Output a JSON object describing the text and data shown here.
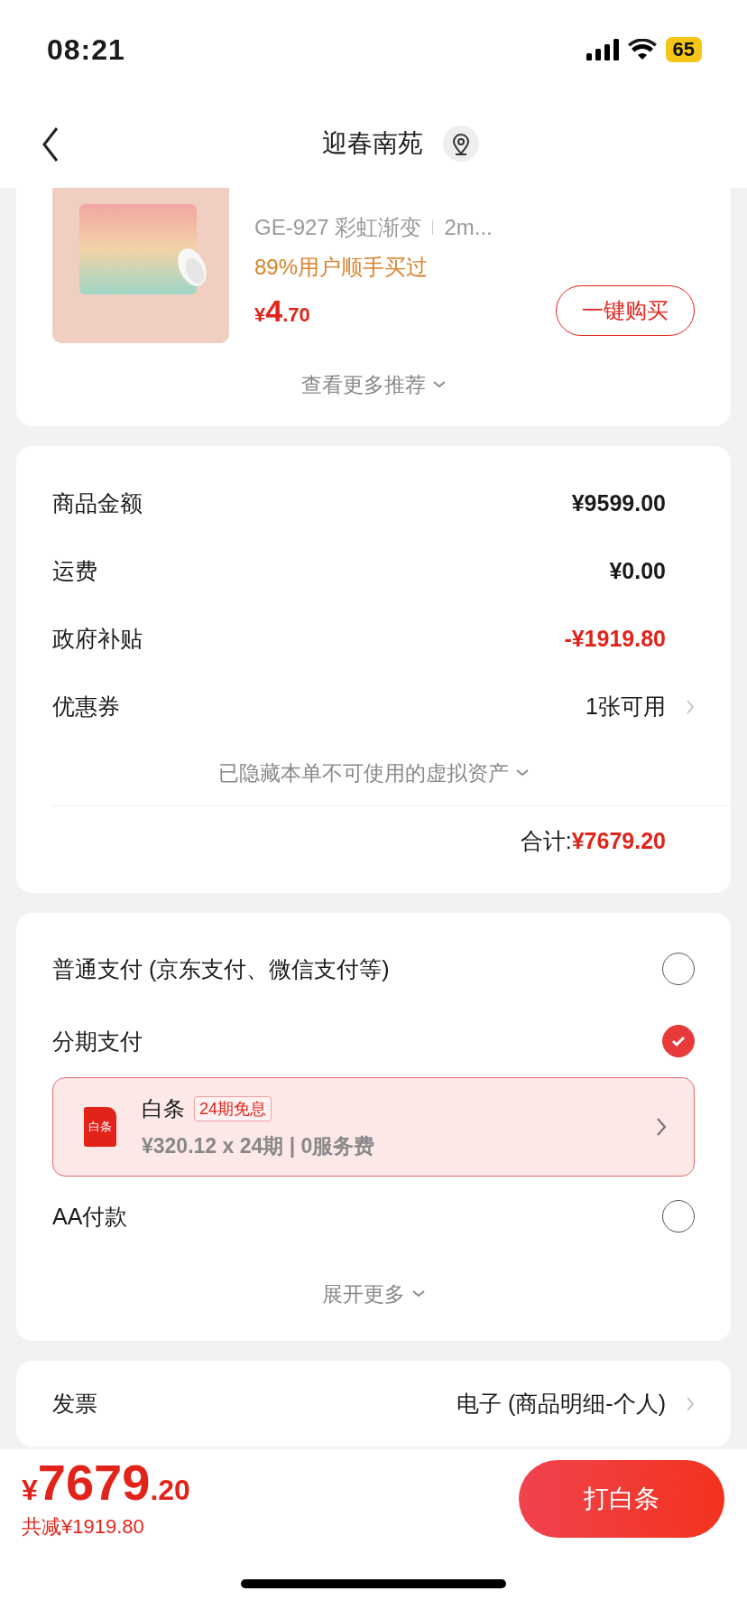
{
  "status_bar": {
    "time": "08:21",
    "battery": "65"
  },
  "nav": {
    "title": "迎春南苑"
  },
  "recommendation": {
    "specs": [
      "GE-927 彩虹渐变",
      "2m..."
    ],
    "social_proof": "89%用户顺手买过",
    "price": {
      "symbol": "¥",
      "integer": "4",
      "decimal": ".70"
    },
    "buy_button": "一键购买",
    "more": "查看更多推荐"
  },
  "summary": {
    "rows": [
      {
        "label": "商品金额",
        "value": "¥9599.00",
        "kind": "plain"
      },
      {
        "label": "运费",
        "value": "¥0.00",
        "kind": "plain"
      },
      {
        "label": "政府补贴",
        "value": "-¥1919.80",
        "kind": "discount"
      },
      {
        "label": "优惠券",
        "value": "1张可用",
        "kind": "link"
      }
    ],
    "hidden_note": "已隐藏本单不可使用的虚拟资产",
    "total_label": "合计:",
    "total_value": "¥7679.20"
  },
  "payment": {
    "options": [
      {
        "label": "普通支付 (京东支付、微信支付等)",
        "selected": false
      },
      {
        "label": "分期支付",
        "selected": true,
        "plan": {
          "logo_text": "白条",
          "name": "白条",
          "badge": "24期免息",
          "detail": "¥320.12 x 24期 | 0服务费"
        }
      },
      {
        "label": "AA付款",
        "selected": false
      }
    ],
    "more": "展开更多"
  },
  "invoice": {
    "label": "发票",
    "value": "电子 (商品明细-个人)"
  },
  "checkout": {
    "price": {
      "symbol": "¥",
      "integer": "7679",
      "decimal": ".20"
    },
    "savings": "共减¥1919.80",
    "button": "打白条"
  }
}
